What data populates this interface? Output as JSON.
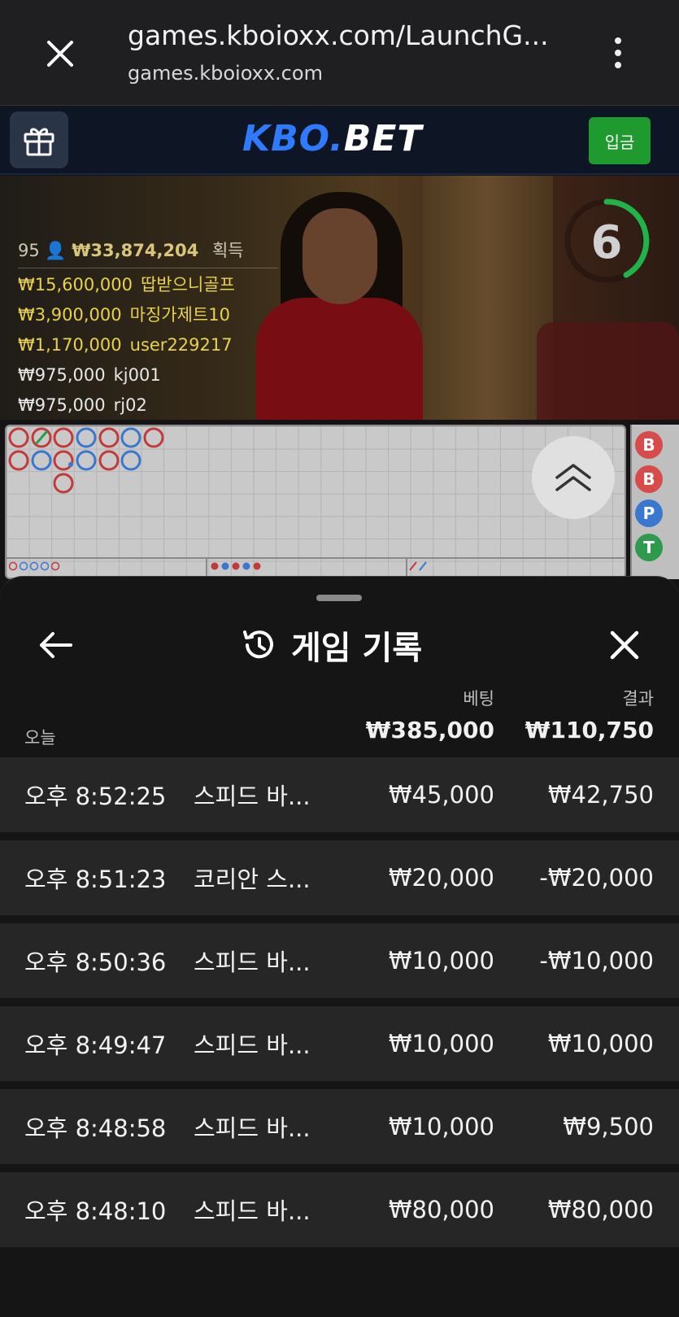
{
  "browser": {
    "url": "games.kboioxx.com/LaunchG...",
    "host": "games.kboioxx.com"
  },
  "site": {
    "logo_kbo": "KBO.",
    "logo_bet": "BET",
    "deposit_label": "입금"
  },
  "live": {
    "count": "95",
    "total_won": "₩33,874,204",
    "won_label": "획득",
    "winners": [
      {
        "amount": "₩15,600,000",
        "name": "땁받으니골프",
        "tier": "gold"
      },
      {
        "amount": "₩3,900,000",
        "name": "마징가제트10",
        "tier": "gold"
      },
      {
        "amount": "₩1,170,000",
        "name": "user229217",
        "tier": "gold"
      },
      {
        "amount": "₩975,000",
        "name": "kj001",
        "tier": "white"
      },
      {
        "amount": "₩975,000",
        "name": "rj02",
        "tier": "white"
      }
    ],
    "timer": "6"
  },
  "road": {
    "side_chips": [
      {
        "label": "B",
        "color": "#d84b4b"
      },
      {
        "label": "B",
        "color": "#d84b4b"
      },
      {
        "label": "P",
        "color": "#3a78d0"
      },
      {
        "label": "T",
        "color": "#2d9a4e"
      }
    ]
  },
  "history": {
    "title": "게임 기록",
    "bet_header": "베팅",
    "result_header": "결과",
    "today_label": "오늘",
    "total_bet": "₩385,000",
    "total_result": "₩110,750",
    "rows": [
      {
        "time": "오후 8:52:25",
        "game": "스피드 바...",
        "bet": "₩45,000",
        "result": "₩42,750"
      },
      {
        "time": "오후 8:51:23",
        "game": "코리안 스...",
        "bet": "₩20,000",
        "result": "-₩20,000"
      },
      {
        "time": "오후 8:50:36",
        "game": "스피드 바...",
        "bet": "₩10,000",
        "result": "-₩10,000"
      },
      {
        "time": "오후 8:49:47",
        "game": "스피드 바...",
        "bet": "₩10,000",
        "result": "₩10,000"
      },
      {
        "time": "오후 8:48:58",
        "game": "스피드 바...",
        "bet": "₩10,000",
        "result": "₩9,500"
      },
      {
        "time": "오후 8:48:10",
        "game": "스피드 바...",
        "bet": "₩80,000",
        "result": "₩80,000"
      }
    ]
  }
}
